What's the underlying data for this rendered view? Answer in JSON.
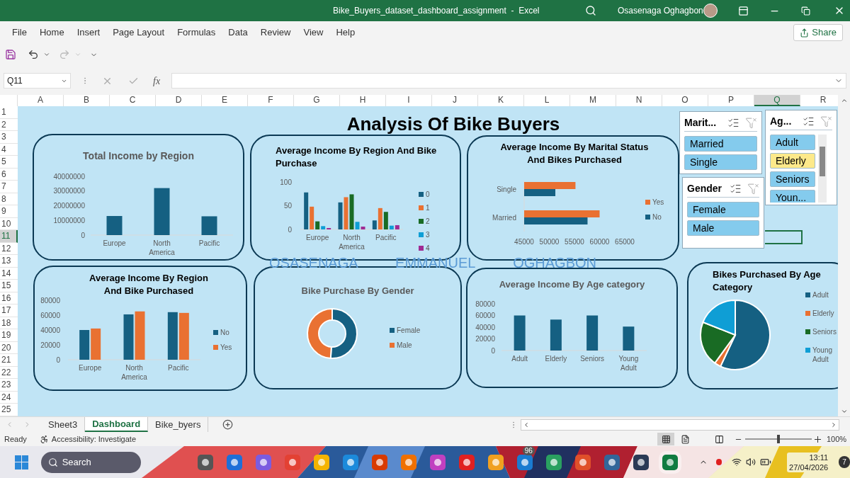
{
  "window": {
    "title": "Bike_Buyers_dataset_dashboard_assignment  -  Excel",
    "user": "Osasenaga Oghagbon"
  },
  "ribbon_tabs": [
    "File",
    "Home",
    "Insert",
    "Page Layout",
    "Formulas",
    "Data",
    "Review",
    "View",
    "Help"
  ],
  "share": "Share",
  "formula_bar": {
    "name_box": "Q11",
    "fx": "fx"
  },
  "columns": [
    {
      "label": "A",
      "selected": false
    },
    {
      "label": "B",
      "selected": false
    },
    {
      "label": "C",
      "selected": false
    },
    {
      "label": "D",
      "selected": false
    },
    {
      "label": "E",
      "selected": false
    },
    {
      "label": "F",
      "selected": false
    },
    {
      "label": "G",
      "selected": false
    },
    {
      "label": "H",
      "selected": false
    },
    {
      "label": "I",
      "selected": false
    },
    {
      "label": "J",
      "selected": false
    },
    {
      "label": "K",
      "selected": false
    },
    {
      "label": "L",
      "selected": false
    },
    {
      "label": "M",
      "selected": false
    },
    {
      "label": "N",
      "selected": false
    },
    {
      "label": "O",
      "selected": false
    },
    {
      "label": "P",
      "selected": false
    },
    {
      "label": "Q",
      "selected": true
    },
    {
      "label": "R",
      "selected": false
    }
  ],
  "rows": [
    {
      "label": "1",
      "selected": false
    },
    {
      "label": "2",
      "selected": false
    },
    {
      "label": "3",
      "selected": false
    },
    {
      "label": "4",
      "selected": false
    },
    {
      "label": "5",
      "selected": false
    },
    {
      "label": "6",
      "selected": false
    },
    {
      "label": "7",
      "selected": false
    },
    {
      "label": "8",
      "selected": false
    },
    {
      "label": "9",
      "selected": false
    },
    {
      "label": "10",
      "selected": false
    },
    {
      "label": "11",
      "selected": true
    },
    {
      "label": "12",
      "selected": false
    },
    {
      "label": "13",
      "selected": false
    },
    {
      "label": "14",
      "selected": false
    },
    {
      "label": "15",
      "selected": false
    },
    {
      "label": "16",
      "selected": false
    },
    {
      "label": "17",
      "selected": false
    },
    {
      "label": "18",
      "selected": false
    },
    {
      "label": "19",
      "selected": false
    },
    {
      "label": "20",
      "selected": false
    },
    {
      "label": "21",
      "selected": false
    },
    {
      "label": "22",
      "selected": false
    },
    {
      "label": "23",
      "selected": false
    },
    {
      "label": "24",
      "selected": false
    },
    {
      "label": "25",
      "selected": false
    }
  ],
  "dashboard": {
    "title": "Analysis Of Bike Buyers",
    "author": "OSASENAGA EMMANUEL OGHAGBON",
    "charts": [
      {
        "chart_data": {
          "type": "bar",
          "title": "Total Income by Region",
          "categories": [
            "Europe",
            "North America",
            "Pacific"
          ],
          "series": [
            {
              "color": "#156082",
              "values": [
                13000000,
                32000000,
                12800000
              ]
            }
          ],
          "ylim": [
            0,
            40000000
          ],
          "yticks": [
            0,
            10000000,
            20000000,
            30000000,
            40000000
          ]
        }
      },
      {
        "chart_data": {
          "type": "bar",
          "legend": "right",
          "title": "Average Income By Region And Bike Purchase",
          "categories": [
            "Europe",
            "North America",
            "Pacific"
          ],
          "series": [
            {
              "name": "0",
              "color": "#156082",
              "values": [
                78,
                57,
                19
              ]
            },
            {
              "name": "1",
              "color": "#e97132",
              "values": [
                48,
                68,
                45
              ]
            },
            {
              "name": "2",
              "color": "#196b24",
              "values": [
                17,
                74,
                37
              ]
            },
            {
              "name": "3",
              "color": "#0f9ed5",
              "values": [
                7,
                16,
                8
              ]
            },
            {
              "name": "4",
              "color": "#a02b93",
              "values": [
                3,
                6,
                9
              ]
            }
          ],
          "ylim": [
            0,
            100
          ],
          "yticks": [
            0,
            50,
            100
          ]
        }
      },
      {
        "chart_data": {
          "type": "bar",
          "orientation": "horizontal",
          "legend": "right",
          "title": "Average Income By Marital Status And Bikes Purchased",
          "categories": [
            "Single",
            "Married"
          ],
          "series": [
            {
              "name": "Yes",
              "color": "#e97132",
              "values": [
                55200,
                60000
              ]
            },
            {
              "name": "No",
              "color": "#156082",
              "values": [
                51200,
                57600
              ]
            }
          ],
          "xlim": [
            45000,
            65000
          ],
          "xticks": [
            45000,
            50000,
            55000,
            60000,
            65000
          ]
        }
      },
      {
        "chart_data": {
          "type": "bar",
          "legend": "right",
          "title": "Average Income By Region And Bike Purchased",
          "categories": [
            "Europe",
            "North America",
            "Pacific"
          ],
          "series": [
            {
              "name": "No",
              "color": "#156082",
              "values": [
                40000,
                61000,
                64000
              ]
            },
            {
              "name": "Yes",
              "color": "#e97132",
              "values": [
                42000,
                65000,
                63000
              ]
            }
          ],
          "ylim": [
            0,
            80000
          ],
          "yticks": [
            0,
            20000,
            40000,
            60000,
            80000
          ]
        }
      },
      {
        "kind": "donut",
        "title": "Bike Purchase By Gender",
        "legend": [
          {
            "label": "Female",
            "color": "#156082"
          },
          {
            "label": "Male",
            "color": "#e97132"
          }
        ]
      },
      {
        "chart_data": {
          "type": "bar",
          "title": "Average Income By Age category",
          "categories": [
            "Adult",
            "Elderly",
            "Seniors",
            "Young Adult"
          ],
          "series": [
            {
              "color": "#156082",
              "values": [
                60000,
                53000,
                60000,
                41000
              ]
            }
          ],
          "ylim": [
            0,
            80000
          ],
          "yticks": [
            0,
            20000,
            40000,
            60000,
            80000
          ]
        }
      },
      {
        "kind": "pie",
        "title": "Bikes Purchased By Age Category",
        "legend": [
          {
            "label": "Adult",
            "color": "#156082"
          },
          {
            "label": "Elderly",
            "color": "#e97132"
          },
          {
            "label": "Seniors",
            "color": "#196b24"
          },
          {
            "label": "Young Adult",
            "color": "#0f9ed5"
          }
        ]
      }
    ],
    "slicers": [
      {
        "title": "Marit...",
        "items": [
          {
            "label": "Married",
            "selected": true,
            "highlighted": false
          },
          {
            "label": "Single",
            "selected": true,
            "highlighted": false
          }
        ]
      },
      {
        "title": "Ag...",
        "items": [
          {
            "label": "Adult",
            "selected": true,
            "highlighted": false
          },
          {
            "label": "Elderly",
            "selected": true,
            "highlighted": true
          },
          {
            "label": "Seniors",
            "selected": true,
            "highlighted": false
          },
          {
            "label": "Youn...",
            "selected": true,
            "highlighted": false
          }
        ]
      },
      {
        "title": "Gender",
        "items": [
          {
            "label": "Female",
            "selected": true,
            "highlighted": false
          },
          {
            "label": "Male",
            "selected": true,
            "highlighted": false
          }
        ]
      }
    ]
  },
  "sheet_tabs": [
    {
      "label": "Sheet3",
      "selected": false
    },
    {
      "label": "Dashboard",
      "selected": true
    },
    {
      "label": "Bike_byers",
      "selected": false
    }
  ],
  "status_bar": {
    "status": "Ready",
    "accessibility": "Accessibility: Investigate",
    "zoom": "100%",
    "zoom_slider": {
      "level": 0.5
    }
  },
  "taskbar": {
    "search": "Search",
    "badge": "96",
    "time": "13:11",
    "date": "27/04/2026",
    "notifications": "7"
  }
}
